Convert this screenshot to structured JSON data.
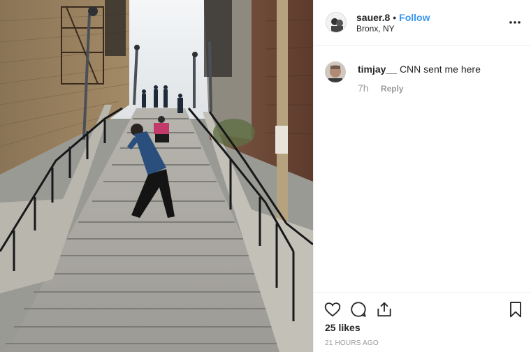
{
  "post": {
    "username": "sauer.8",
    "separator": "•",
    "follow_label": "Follow",
    "location": "Bronx, NY"
  },
  "comments": [
    {
      "username": "timjay__",
      "text": "CNN sent me here",
      "time": "7h",
      "reply_label": "Reply"
    }
  ],
  "footer": {
    "likes": "25 likes",
    "timestamp": "21 HOURS AGO"
  },
  "icons": {
    "more": "more-options-icon",
    "like": "heart-icon",
    "comment": "comment-icon",
    "share": "share-icon",
    "save": "bookmark-icon"
  },
  "colors": {
    "accent": "#3897f0",
    "text": "#262626",
    "muted": "#999999",
    "divider": "#efefef"
  }
}
